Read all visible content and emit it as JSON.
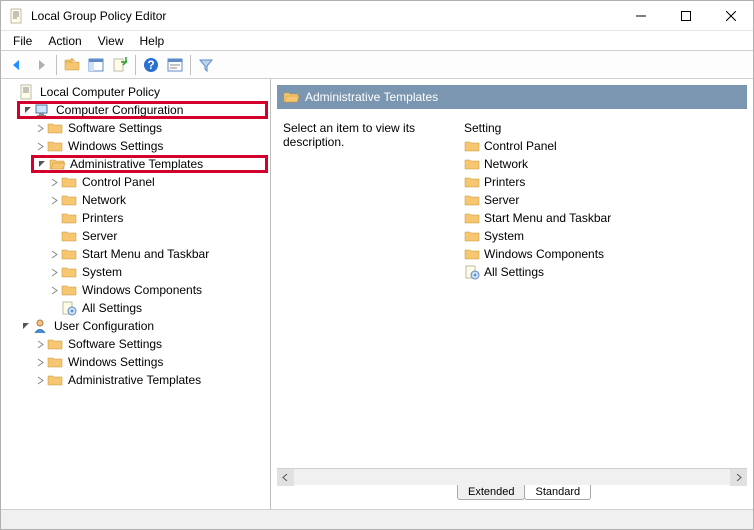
{
  "window": {
    "title": "Local Group Policy Editor"
  },
  "menu": {
    "items": [
      "File",
      "Action",
      "View",
      "Help"
    ]
  },
  "tree": {
    "root": "Local Computer Policy",
    "comp_cfg": "Computer Configuration",
    "comp_children": {
      "software": "Software Settings",
      "windows": "Windows Settings",
      "admin": "Administrative Templates",
      "admin_children": {
        "control_panel": "Control Panel",
        "network": "Network",
        "printers": "Printers",
        "server": "Server",
        "start_menu": "Start Menu and Taskbar",
        "system": "System",
        "win_comp": "Windows Components",
        "all_settings": "All Settings"
      }
    },
    "user_cfg": "User Configuration",
    "user_children": {
      "software": "Software Settings",
      "windows": "Windows Settings",
      "admin": "Administrative Templates"
    }
  },
  "content": {
    "header": "Administrative Templates",
    "description": "Select an item to view its description.",
    "list_header": "Setting",
    "items": {
      "control_panel": "Control Panel",
      "network": "Network",
      "printers": "Printers",
      "server": "Server",
      "start_menu": "Start Menu and Taskbar",
      "system": "System",
      "win_comp": "Windows Components",
      "all_settings": "All Settings"
    }
  },
  "tabs": {
    "extended": "Extended",
    "standard": "Standard"
  }
}
